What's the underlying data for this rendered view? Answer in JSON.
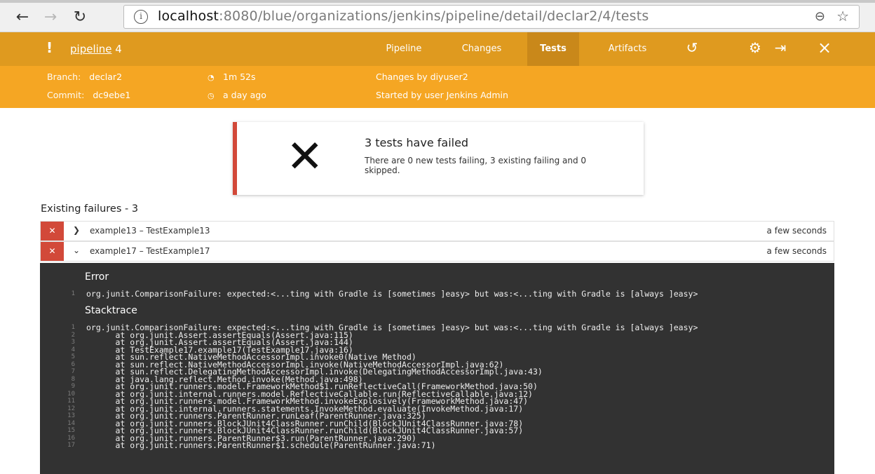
{
  "browser": {
    "back_icon": "arrow-left-icon",
    "forward_icon": "arrow-right-icon",
    "reload_icon": "reload-icon",
    "url_host": "localhost",
    "url_path": ":8080/blue/organizations/jenkins/pipeline/detail/declar2/4/tests",
    "zoom_icon": "zoom-out-icon",
    "bookmark_icon": "star-icon"
  },
  "header": {
    "status_mark": "!",
    "pipeline_name": "pipeline",
    "run_number": "4",
    "tabs": [
      "Pipeline",
      "Changes",
      "Tests",
      "Artifacts"
    ],
    "active_tab": "Tests",
    "bar_color": "#df9a1f"
  },
  "details": {
    "branch_label": "Branch:",
    "branch_value": "declar2",
    "commit_label": "Commit:",
    "commit_value": "dc9ebe1",
    "duration": "1m 52s",
    "time_ago": "a day ago",
    "changes": "Changes by diyuser2",
    "started": "Started by user Jenkins Admin",
    "bar_color": "#f5a623"
  },
  "summary": {
    "title": "3 tests have failed",
    "text": "There are 0 new tests failing, 3 existing failing and 0 skipped.",
    "accent": "#d24939"
  },
  "section_title": "Existing failures - 3",
  "failures": [
    {
      "name": "example13 – TestExample13",
      "duration": "a few seconds",
      "expanded": false
    },
    {
      "name": "example17 – TestExample17",
      "duration": "a few seconds",
      "expanded": true
    }
  ],
  "console": {
    "error_heading": "Error",
    "error_lines": [
      {
        "n": "1",
        "t": "org.junit.ComparisonFailure: expected:<...ting with Gradle is [sometimes ]easy> but was:<...ting with Gradle is [always ]easy>"
      }
    ],
    "stack_heading": "Stacktrace",
    "stack_lines": [
      {
        "n": "1",
        "t": "org.junit.ComparisonFailure: expected:<...ting with Gradle is [sometimes ]easy> but was:<...ting with Gradle is [always ]easy>"
      },
      {
        "n": "2",
        "t": "      at org.junit.Assert.assertEquals(Assert.java:115)"
      },
      {
        "n": "3",
        "t": "      at org.junit.Assert.assertEquals(Assert.java:144)"
      },
      {
        "n": "4",
        "t": "      at TestExample17.example17(TestExample17.java:16)"
      },
      {
        "n": "5",
        "t": "      at sun.reflect.NativeMethodAccessorImpl.invoke0(Native Method)"
      },
      {
        "n": "6",
        "t": "      at sun.reflect.NativeMethodAccessorImpl.invoke(NativeMethodAccessorImpl.java:62)"
      },
      {
        "n": "7",
        "t": "      at sun.reflect.DelegatingMethodAccessorImpl.invoke(DelegatingMethodAccessorImpl.java:43)"
      },
      {
        "n": "8",
        "t": "      at java.lang.reflect.Method.invoke(Method.java:498)"
      },
      {
        "n": "9",
        "t": "      at org.junit.runners.model.FrameworkMethod$1.runReflectiveCall(FrameworkMethod.java:50)"
      },
      {
        "n": "10",
        "t": "      at org.junit.internal.runners.model.ReflectiveCallable.run(ReflectiveCallable.java:12)"
      },
      {
        "n": "11",
        "t": "      at org.junit.runners.model.FrameworkMethod.invokeExplosively(FrameworkMethod.java:47)"
      },
      {
        "n": "12",
        "t": "      at org.junit.internal.runners.statements.InvokeMethod.evaluate(InvokeMethod.java:17)"
      },
      {
        "n": "13",
        "t": "      at org.junit.runners.ParentRunner.runLeaf(ParentRunner.java:325)"
      },
      {
        "n": "14",
        "t": "      at org.junit.runners.BlockJUnit4ClassRunner.runChild(BlockJUnit4ClassRunner.java:78)"
      },
      {
        "n": "15",
        "t": "      at org.junit.runners.BlockJUnit4ClassRunner.runChild(BlockJUnit4ClassRunner.java:57)"
      },
      {
        "n": "16",
        "t": "      at org.junit.runners.ParentRunner$3.run(ParentRunner.java:290)"
      },
      {
        "n": "17",
        "t": "      at org.junit.runners.ParentRunner$1.schedule(ParentRunner.java:71)"
      }
    ]
  }
}
